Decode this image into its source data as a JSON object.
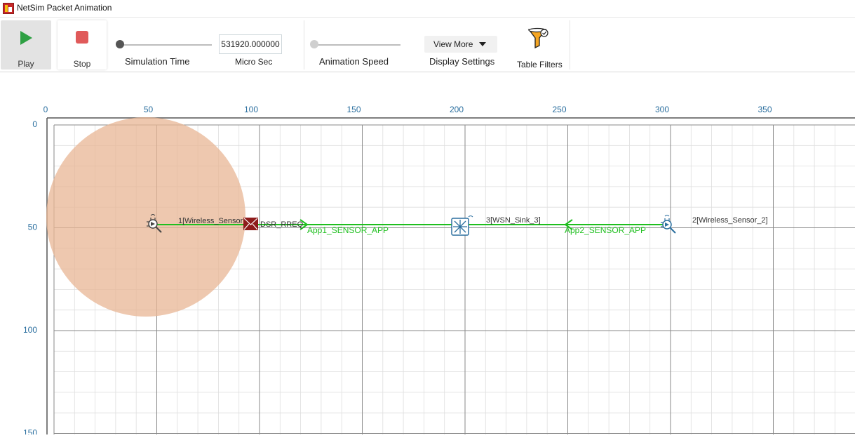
{
  "window": {
    "title": "NetSim Packet Animation"
  },
  "toolbar": {
    "play_label": "Play",
    "stop_label": "Stop",
    "simulation_time_label": "Simulation Time",
    "micro_sec_value": "531920.000000",
    "micro_sec_label": "Micro Sec",
    "animation_speed_label": "Animation Speed",
    "view_more_label": "View More",
    "display_settings_label": "Display Settings",
    "table_filters_label": "Table Filters"
  },
  "grid": {
    "x_ticks": [
      "0",
      "50",
      "100",
      "150",
      "200",
      "250",
      "300",
      "350"
    ],
    "y_ticks": [
      "0",
      "50",
      "100",
      "150"
    ],
    "major_spacing": 50,
    "minor_spacing": 10
  },
  "nodes": [
    {
      "id": "1",
      "label": "1[Wireless_Sensor_1]",
      "type": "wireless-sensor"
    },
    {
      "id": "3",
      "label": "3[WSN_Sink_3]",
      "type": "wsn-sink"
    },
    {
      "id": "2",
      "label": "2[Wireless_Sensor_2]",
      "type": "wireless-sensor"
    }
  ],
  "links": [
    {
      "label": "App1_SENSOR_APP",
      "color": "#1fbf1f"
    },
    {
      "label": "App2_SENSOR_APP",
      "color": "#1fbf1f"
    }
  ],
  "packet": {
    "label": "DSR_RREQ"
  },
  "colors": {
    "range_circle": "#e8b694",
    "link_green": "#1fbf1f",
    "axis_tick": "#2b6f9f",
    "play_green": "#2ea043",
    "stop_red": "#e05a5a",
    "packet_red": "#8e1b1b"
  }
}
